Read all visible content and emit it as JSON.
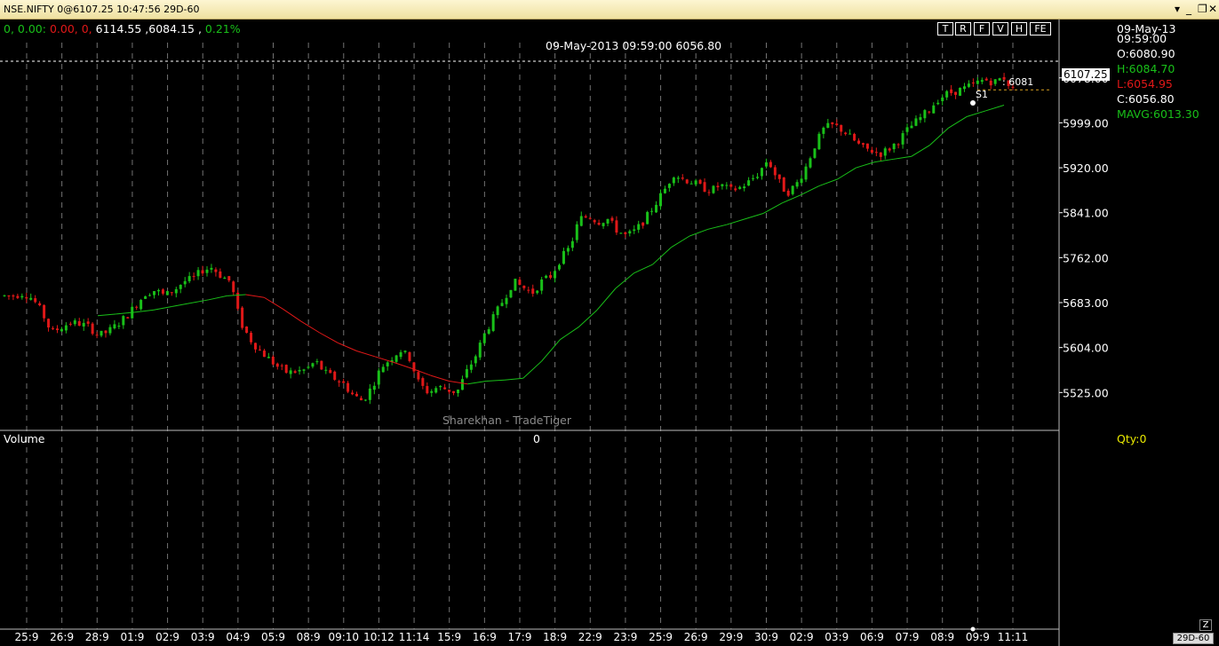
{
  "window": {
    "title": "NSE.NIFTY 0@6107.25 10:47:56 29D-60"
  },
  "info": {
    "change": "0, 0.00:",
    "change_red": "0.00, 0,",
    "hi_lo": "6114.55 ,6084.15 ,",
    "pct": "0.21%"
  },
  "buttons": [
    "T",
    "R",
    "F",
    "V",
    "H",
    "FE"
  ],
  "cursor_info": "09-May-2013 09:59:00 6056.80",
  "right_panel": {
    "date": "09-May-13",
    "time": "09:59:00",
    "open": "O:6080.90",
    "high": "H:6084.70",
    "low": "L:6054.95",
    "close": "C:6056.80",
    "mavg": "MAVG:6013.30",
    "qty": "Qty:0"
  },
  "last_price": "6107.25",
  "label_s1": "S1",
  "label_6081": ": 6081",
  "watermark": "Sharekhan - TradeTiger",
  "volume": {
    "label": "Volume",
    "value": "0"
  },
  "zoom_button": "Z",
  "period_badge": "29D-60",
  "colors": {
    "up": "#19c019",
    "down": "#e01818",
    "ma": "#19c019",
    "ma_down": "#e01818",
    "grid": "#d0d0d0"
  },
  "chart_data": {
    "type": "candlestick",
    "ylim": [
      5460,
      6140
    ],
    "y_ticks": [
      6078.0,
      5999.0,
      5920.0,
      5841.0,
      5762.0,
      5683.0,
      5604.0,
      5525.0
    ],
    "y_tick_labels": [
      "6078.00",
      "5999.00",
      "5920.00",
      "5841.00",
      "5762.00",
      "5683.00",
      "5604.00",
      "5525.00"
    ],
    "x_labels": [
      "25:9",
      "26:9",
      "28:9",
      "01:9",
      "02:9",
      "03:9",
      "04:9",
      "05:9",
      "08:9",
      "09:10",
      "10:12",
      "11:14",
      "15:9",
      "16:9",
      "17:9",
      "18:9",
      "22:9",
      "23:9",
      "25:9",
      "26:9",
      "29:9",
      "30:9",
      "02:9",
      "03:9",
      "06:9",
      "07:9",
      "08:9",
      "09:9",
      "11:11"
    ],
    "close_trend": [
      5695,
      5695,
      5700,
      5690,
      5665,
      5630,
      5640,
      5648,
      5646,
      5640,
      5625,
      5632,
      5645,
      5660,
      5680,
      5700,
      5705,
      5695,
      5705,
      5720,
      5725,
      5740,
      5745,
      5730,
      5720,
      5650,
      5620,
      5600,
      5585,
      5570,
      5560,
      5562,
      5565,
      5580,
      5560,
      5550,
      5540,
      5520,
      5510,
      5535,
      5570,
      5585,
      5600,
      5585,
      5540,
      5525,
      5535,
      5530,
      5525,
      5560,
      5590,
      5630,
      5660,
      5690,
      5720,
      5710,
      5700,
      5720,
      5730,
      5760,
      5780,
      5830,
      5835,
      5825,
      5830,
      5810,
      5800,
      5810,
      5830,
      5855,
      5880,
      5910,
      5900,
      5895,
      5885,
      5880,
      5890,
      5880,
      5885,
      5895,
      5910,
      5935,
      5900,
      5875,
      5890,
      5920,
      5960,
      5990,
      5995,
      5985,
      5970,
      5955,
      5950,
      5945,
      5955,
      5970,
      5990,
      6005,
      6020,
      6040,
      6050,
      6055,
      6060,
      6068,
      6075,
      6070,
      6080,
      6057
    ],
    "ma": [
      5660,
      5663,
      5666,
      5670,
      5676,
      5682,
      5688,
      5695,
      5697,
      5692,
      5672,
      5650,
      5630,
      5612,
      5598,
      5588,
      5578,
      5567,
      5555,
      5545,
      5540,
      5545,
      5547,
      5550,
      5580,
      5618,
      5640,
      5670,
      5708,
      5735,
      5750,
      5780,
      5800,
      5812,
      5820,
      5830,
      5840,
      5858,
      5872,
      5888,
      5900,
      5920,
      5930,
      5935,
      5940,
      5960,
      5990,
      6010,
      6020,
      6030
    ]
  }
}
